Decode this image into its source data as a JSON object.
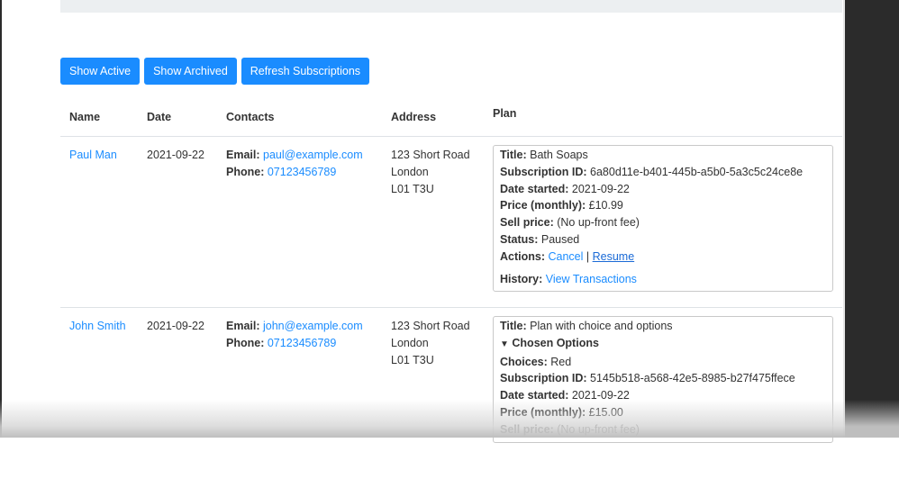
{
  "toolbar": {
    "show_active": "Show Active",
    "show_archived": "Show Archived",
    "refresh": "Refresh Subscriptions"
  },
  "table": {
    "headers": {
      "name": "Name",
      "date": "Date",
      "contacts": "Contacts",
      "address": "Address",
      "plan": "Plan"
    },
    "rows": [
      {
        "name": "Paul Man",
        "date": "2021-09-22",
        "email_label": "Email:",
        "email": "paul@example.com",
        "phone_label": "Phone:",
        "phone": "07123456789",
        "address_line1": "123 Short Road",
        "address_line2": "London",
        "address_line3": "L01 T3U",
        "plan": {
          "title_label": "Title:",
          "title": "Bath Soaps",
          "sub_id_label": "Subscription ID:",
          "sub_id": "6a80d11e-b401-445b-a5b0-5a3c5c24ce8e",
          "date_started_label": "Date started:",
          "date_started": "2021-09-22",
          "price_label": "Price (monthly):",
          "price": "£10.99",
          "sell_label": "Sell price:",
          "sell": "(No up-front fee)",
          "status_label": "Status:",
          "status": "Paused",
          "actions_label": "Actions:",
          "cancel": "Cancel",
          "separator": "|",
          "resume": "Resume",
          "history_label": "History:",
          "history_link": "View Transactions"
        }
      },
      {
        "name": "John Smith",
        "date": "2021-09-22",
        "email_label": "Email:",
        "email": "john@example.com",
        "phone_label": "Phone:",
        "phone": "07123456789",
        "address_line1": "123 Short Road",
        "address_line2": "London",
        "address_line3": "L01 T3U",
        "plan": {
          "title_label": "Title:",
          "title": "Plan with choice and options",
          "options_caret": "▼",
          "options_label": "Chosen Options",
          "choices_label": "Choices:",
          "choices": "Red",
          "sub_id_label": "Subscription ID:",
          "sub_id": "5145b518-a568-42e5-8985-b27f475ffece",
          "date_started_label": "Date started:",
          "date_started": "2021-09-22",
          "price_label": "Price (monthly):",
          "price": "£15.00",
          "sell_label": "Sell price:",
          "sell": "(No up-front fee)"
        }
      }
    ]
  }
}
